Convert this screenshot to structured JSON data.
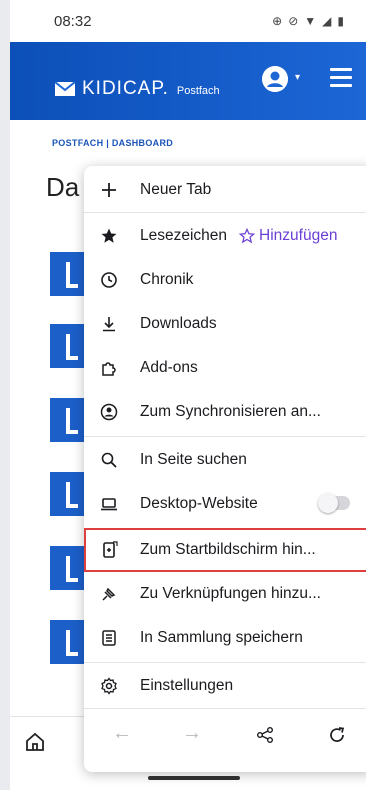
{
  "status_bar": {
    "time": "08:32"
  },
  "header": {
    "brand": "KIDICAP.",
    "brand_sub": "Postfach"
  },
  "breadcrumb": {
    "first": "POSTFACH",
    "separator": "|",
    "second": "DASHBOARD"
  },
  "page": {
    "title_partial": "Da"
  },
  "menu": {
    "items": [
      {
        "label": "Neuer Tab",
        "icon": "plus-icon"
      },
      {
        "label": "Lesezeichen",
        "icon": "star-filled-icon",
        "action": "Hinzufügen",
        "action_icon": "star-outline-icon"
      },
      {
        "label": "Chronik",
        "icon": "clock-icon"
      },
      {
        "label": "Downloads",
        "icon": "download-icon"
      },
      {
        "label": "Add-ons",
        "icon": "puzzle-icon"
      },
      {
        "label": "Zum Synchronisieren an...",
        "icon": "account-sync-icon"
      },
      {
        "label": "In Seite suchen",
        "icon": "search-icon"
      },
      {
        "label": "Desktop-Website",
        "icon": "laptop-icon",
        "toggle": false
      },
      {
        "label": "Zum Startbildschirm hin...",
        "icon": "add-to-homescreen-icon",
        "highlighted": true
      },
      {
        "label": "Zu Verknüpfungen hinzu...",
        "icon": "pin-icon"
      },
      {
        "label": "In Sammlung speichern",
        "icon": "collection-icon"
      },
      {
        "label": "Einstellungen",
        "icon": "gear-icon"
      }
    ],
    "footer": {
      "back": "←",
      "forward": "→",
      "share": "share-icon",
      "reload": "reload-icon"
    }
  },
  "colors": {
    "header_bg": "#1c66d6",
    "accent": "#6b3fd6",
    "highlight_border": "#e0403b"
  }
}
